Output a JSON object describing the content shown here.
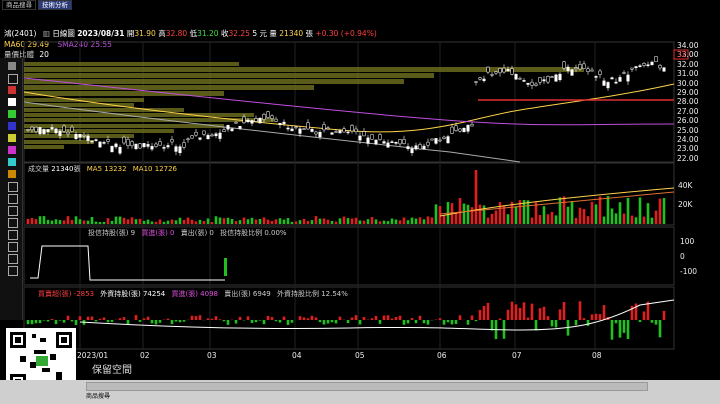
{
  "tabs": [
    "商品搜尋",
    "技術分析"
  ],
  "header": {
    "ticker": "鴻(2401)",
    "chart_type_icon": "candlestick-icon",
    "chart_type": "日線圖",
    "date": "2023/08/31",
    "open_label": "開",
    "open": "31.90",
    "high_label": "高",
    "high": "32.80",
    "low_label": "低",
    "low": "31.20",
    "close_label": "收",
    "close": "32.25",
    "unit": "5 元",
    "volume_label": "量",
    "volume": "21340",
    "volume_unit": "張",
    "change": "+0.30",
    "change_pct": "(+0.94%)"
  },
  "ma_row": {
    "ma60": "MA60 29.49",
    "ma240": "SMA240 25.55",
    "profile": "量價比體",
    "profile_value": "20"
  },
  "price_axis": [
    "34.00",
    "33.00",
    "32.00",
    "31.00",
    "30.00",
    "29.00",
    "28.00",
    "27.00",
    "26.00",
    "25.00",
    "24.00",
    "23.00",
    "22.00"
  ],
  "price_box": "32",
  "volume_panel": {
    "label": "成交量",
    "value": "21340",
    "unit": "張",
    "ma5": "MA5 13232",
    "ma10": "MA10 12726",
    "axis": [
      "40K",
      "20K"
    ]
  },
  "chip_panel": {
    "items": [
      "投信持股(張) 9",
      "買進(張) 0",
      "賣出(張) 0",
      "投信持股比例 0.00%"
    ],
    "axis": [
      "100",
      "0",
      "-100"
    ]
  },
  "foreign_panel": {
    "items": [
      "買賣超(張) -2853",
      "外資持股(張) 74254",
      "買進(張) 4098",
      "賣出(張) 6949",
      "外資持股比例 12.54%"
    ]
  },
  "time_axis": [
    "2023/01",
    "02",
    "03",
    "04",
    "05",
    "06",
    "07",
    "08"
  ],
  "banner": "保留空間",
  "status_text": "商品搜尋",
  "colors": {
    "up": "#e02020",
    "down": "#20c020",
    "ma_yellow": "#ffd24a",
    "ma_purple": "#c050e0",
    "profile": "#6b6b1e"
  }
}
